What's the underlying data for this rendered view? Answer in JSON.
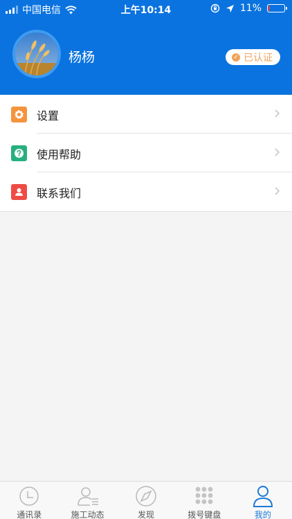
{
  "status_bar": {
    "carrier": "中国电信",
    "time": "上午10:14",
    "battery": "11%",
    "battery_level": 0.11,
    "battery_color": "#ff3b30"
  },
  "profile": {
    "name": "杨杨",
    "badge": "已认证",
    "avatar_icon": "wheat-photo"
  },
  "menu": {
    "items": [
      {
        "label": "设置",
        "icon": "gear-icon",
        "color": "#f5943e"
      },
      {
        "label": "使用帮助",
        "icon": "help-icon",
        "color": "#27b07e"
      },
      {
        "label": "联系我们",
        "icon": "contact-icon",
        "color": "#ef4b45"
      }
    ]
  },
  "tabbar": {
    "tabs": [
      {
        "label": "通讯录",
        "icon": "clock-icon",
        "active": false
      },
      {
        "label": "施工动态",
        "icon": "person-list-icon",
        "active": false
      },
      {
        "label": "发现",
        "icon": "compass-icon",
        "active": false
      },
      {
        "label": "拨号键盘",
        "icon": "keypad-icon",
        "active": false
      },
      {
        "label": "我的",
        "icon": "person-icon",
        "active": true
      }
    ]
  },
  "colors": {
    "header_bg": "#0a73e0",
    "accent": "#1c7ad8",
    "badge_text": "#f0a35a"
  }
}
